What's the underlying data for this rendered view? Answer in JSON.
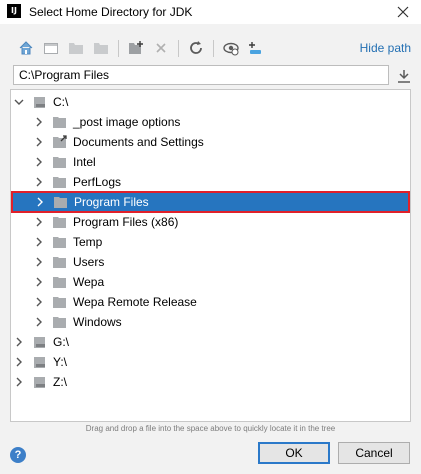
{
  "window": {
    "title": "Select Home Directory for JDK",
    "app_icon_text": "IJ"
  },
  "toolbar": {
    "hide_path_label": "Hide path"
  },
  "path": {
    "value": "C:\\Program Files"
  },
  "tree": {
    "items": [
      {
        "label": "C:\\",
        "type": "drive",
        "expanded": true
      },
      {
        "label": "_post image options",
        "type": "folder"
      },
      {
        "label": "Documents and Settings",
        "type": "folder-link"
      },
      {
        "label": "Intel",
        "type": "folder"
      },
      {
        "label": "PerfLogs",
        "type": "folder"
      },
      {
        "label": "Program Files",
        "type": "folder",
        "selected": true
      },
      {
        "label": "Program Files (x86)",
        "type": "folder"
      },
      {
        "label": "Temp",
        "type": "folder"
      },
      {
        "label": "Users",
        "type": "folder"
      },
      {
        "label": "Wepa",
        "type": "folder"
      },
      {
        "label": "Wepa Remote Release",
        "type": "folder"
      },
      {
        "label": "Windows",
        "type": "folder"
      },
      {
        "label": "G:\\",
        "type": "drive"
      },
      {
        "label": "Y:\\",
        "type": "drive"
      },
      {
        "label": "Z:\\",
        "type": "drive"
      }
    ]
  },
  "hint": "Drag and drop a file into the space above to quickly locate it in the tree",
  "buttons": {
    "help": "?",
    "ok": "OK",
    "cancel": "Cancel"
  },
  "colors": {
    "selection": "#2675bf",
    "highlight_border": "#e0202a",
    "link": "#2470b3",
    "folder": "#a9acaf"
  }
}
